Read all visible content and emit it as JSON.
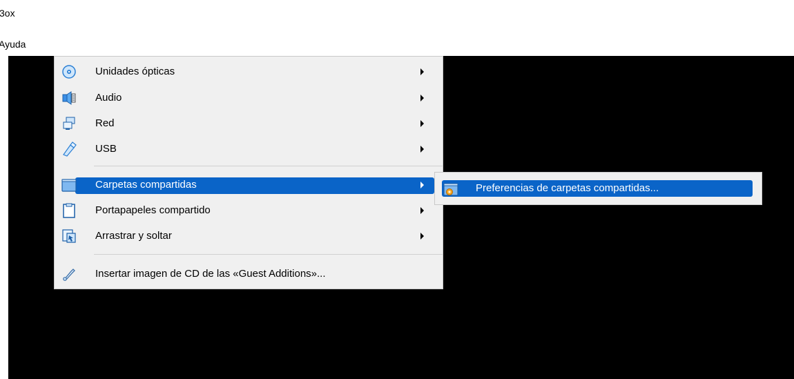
{
  "window": {
    "title_fragment": "3ox",
    "menubar_fragment": "Ayuda"
  },
  "menu": {
    "items": [
      {
        "label": "Unidades ópticas",
        "icon": "optical-disc-icon",
        "has_submenu": true
      },
      {
        "label": "Audio",
        "icon": "audio-icon",
        "has_submenu": true
      },
      {
        "label": "Red",
        "icon": "network-icon",
        "has_submenu": true
      },
      {
        "label": "USB",
        "icon": "usb-icon",
        "has_submenu": true
      },
      {
        "label": "Carpetas compartidas",
        "icon": "shared-folder-icon",
        "has_submenu": true,
        "active": true
      },
      {
        "label": "Portapapeles compartido",
        "icon": "clipboard-icon",
        "has_submenu": true
      },
      {
        "label": "Arrastrar y soltar",
        "icon": "drag-drop-icon",
        "has_submenu": true
      },
      {
        "label": "Insertar imagen de CD de las «Guest Additions»...",
        "icon": "guest-additions-icon",
        "has_submenu": false
      }
    ]
  },
  "submenu": {
    "items": [
      {
        "label": "Preferencias de carpetas compartidas...",
        "icon": "shared-folder-settings-icon",
        "active": true
      }
    ]
  },
  "colors": {
    "highlight": "#0a64c8",
    "menu_bg": "#f0f0f0",
    "vm_screen": "#000000"
  }
}
